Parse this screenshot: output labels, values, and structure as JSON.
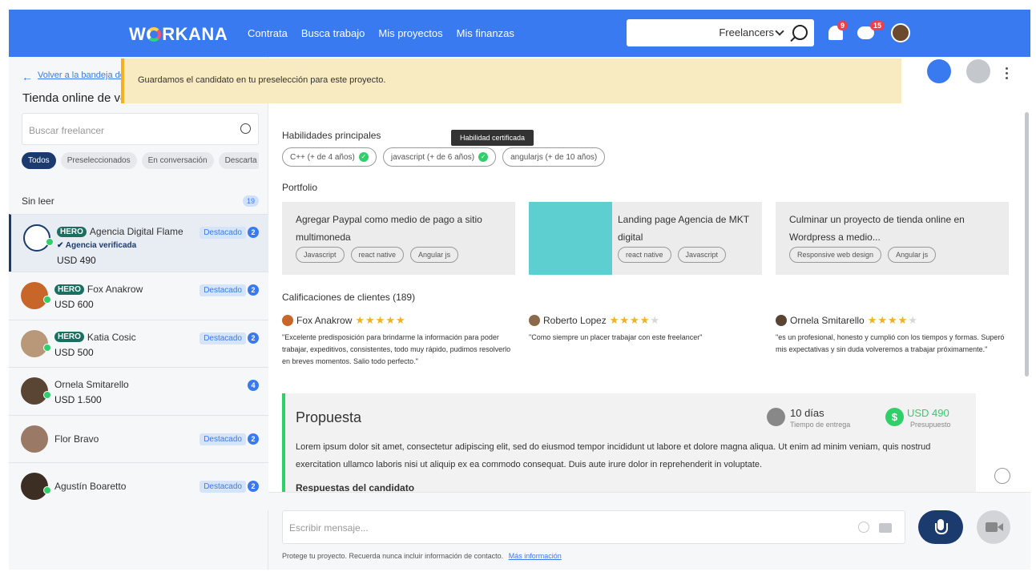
{
  "topbar": {
    "logo": "WORKANA",
    "nav": [
      "Contrata",
      "Busca trabajo",
      "Mis proyectos",
      "Mis finanzas"
    ],
    "search_select": "Freelancers",
    "bell_count": "9",
    "chat_count": "15"
  },
  "sidebar": {
    "back_link": "Volver a la bandeja de me",
    "project_title": "Tienda online de vent",
    "search_placeholder": "Buscar freelancer",
    "filters": [
      "Todos",
      "Preseleccionados",
      "En conversación",
      "Descarta"
    ],
    "unread_label": "Sin leer",
    "unread_count": "19",
    "candidates": [
      {
        "hero": "HERO",
        "name": "Agencia Digital Flame",
        "verified": "Agencia verificada",
        "price": "USD 490",
        "badge": "Destacado",
        "count": "2"
      },
      {
        "hero": "HERO",
        "name": "Fox Anakrow",
        "price": "USD 600",
        "badge": "Destacado",
        "count": "2"
      },
      {
        "hero": "HERO",
        "name": "Katia Cosic",
        "price": "USD 500",
        "badge": "Destacado",
        "count": "2"
      },
      {
        "name": "Ornela Smitarello",
        "price": "USD 1.500",
        "count": "4"
      },
      {
        "name": "Flor Bravo",
        "badge": "Destacado",
        "count": "2"
      },
      {
        "name": "Agustín Boaretto",
        "badge": "Destacado",
        "count": "2"
      }
    ]
  },
  "notice": "Guardamos el candidato en tu preselección para este proyecto.",
  "main": {
    "skills_title": "Habilidades principales",
    "tooltip": "Habilidad certificada",
    "skills": [
      "C++ (+ de 4 años)",
      "javascript (+ de 6 años)",
      "angularjs (+ de 10 años)"
    ],
    "portfolio_title": "Portfolio",
    "portfolio": [
      {
        "title": "Agregar Paypal como medio de pago a sitio multimoneda",
        "tags": [
          "Javascript",
          "react native",
          "Angular js"
        ]
      },
      {
        "title": "Landing page Agencia de MKT digital",
        "tags": [
          "react native",
          "Javascript"
        ]
      },
      {
        "title": "Culminar un proyecto de tienda online en Wordpress a medio...",
        "tags": [
          "Responsive web design",
          "Angular js"
        ]
      }
    ],
    "reviews_title": "Calificaciones de clientes (189)",
    "reviews": [
      {
        "name": "Fox Anakrow",
        "stars": 5,
        "text": "\"Excelente predisposición para brindarme la información para poder trabajar, expeditivos, consistentes, todo muy rápido, pudimos resolverlo en breves momentos. Salio todo perfecto.\""
      },
      {
        "name": "Roberto Lopez",
        "stars": 4,
        "text": "\"Como siempre un placer trabajar con este freelancer\""
      },
      {
        "name": "Ornela Smitarello",
        "stars": 4,
        "text": "\"es un profesional, honesto y cumplió con los tiempos y formas. Superó mis expectativas y sin duda volveremos a trabajar próximamente.\""
      }
    ],
    "proposal": {
      "title": "Propuesta",
      "duration": "10 días",
      "duration_label": "Tiempo de entrega",
      "price": "USD 490",
      "price_label": "Presupuesto",
      "body": "Lorem ipsum dolor sit amet, consectetur adipiscing elit, sed do eiusmod tempor incididunt ut labore et dolore magna aliqua. Ut enim ad minim veniam, quis nostrud exercitation ullamco laboris nisi ut aliquip ex ea commodo consequat. Duis aute irure dolor in reprehenderit in voluptate.",
      "sub": "Respuestas del candidato"
    },
    "composer": {
      "placeholder": "Escribir mensaje...",
      "footnote": "Protege tu proyecto. Recuerda nunca incluir información de contacto.",
      "more_link": "Más información"
    }
  }
}
